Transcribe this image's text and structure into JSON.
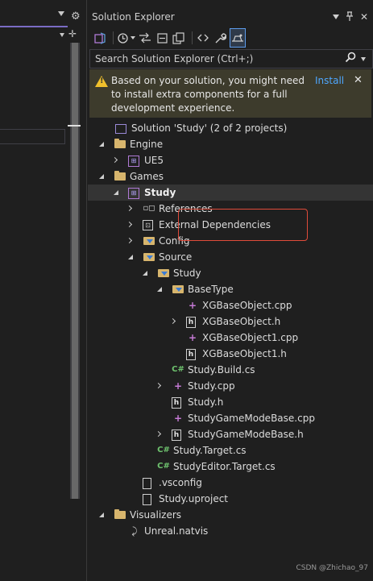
{
  "left_panel": {
    "gear_glyph": "⚙",
    "plus_glyph": "✛"
  },
  "solution_explorer": {
    "title": "Solution Explorer",
    "title_controls": {
      "pin": "⊥",
      "close": "✕"
    },
    "toolbar_icons": [
      "vs-switch-icon",
      "history-icon",
      "back-forward-icon",
      "collapse-all-icon",
      "show-all-files-icon",
      "code-view-icon",
      "properties-wrench-icon",
      "preview-selected-icon"
    ],
    "search": {
      "placeholder": "Search Solution Explorer (Ctrl+;)"
    },
    "info_bar": {
      "message": "Based on your solution, you might need to install extra components for a full development experience.",
      "install_label": "Install",
      "close_glyph": "✕"
    },
    "tree": [
      {
        "label": "Solution 'Study' (2 of 2 projects)",
        "icon": "solution-icon",
        "expander": "none"
      },
      {
        "label": "Engine",
        "icon": "folder-icon",
        "expander": "open"
      },
      {
        "label": "UE5",
        "icon": "project-icon",
        "expander": "closed"
      },
      {
        "label": "Games",
        "icon": "folder-icon",
        "expander": "open"
      },
      {
        "label": "Study",
        "icon": "project-icon",
        "expander": "open",
        "bold": true,
        "selected": true
      },
      {
        "label": "References",
        "icon": "references-icon",
        "expander": "closed"
      },
      {
        "label": "External Dependencies",
        "icon": "external-dependencies-icon",
        "expander": "closed"
      },
      {
        "label": "Config",
        "icon": "filter-folder-icon",
        "expander": "closed"
      },
      {
        "label": "Source",
        "icon": "filter-folder-icon",
        "expander": "open"
      },
      {
        "label": "Study",
        "icon": "filter-folder-icon",
        "expander": "open"
      },
      {
        "label": "BaseType",
        "icon": "filter-folder-icon",
        "expander": "open"
      },
      {
        "label": "XGBaseObject.cpp",
        "icon": "cpp-file-icon",
        "expander": "none"
      },
      {
        "label": "XGBaseObject.h",
        "icon": "header-file-icon",
        "expander": "closed"
      },
      {
        "label": "XGBaseObject1.cpp",
        "icon": "cpp-file-icon",
        "expander": "none"
      },
      {
        "label": "XGBaseObject1.h",
        "icon": "header-file-icon",
        "expander": "none"
      },
      {
        "label": "Study.Build.cs",
        "icon": "csharp-file-icon",
        "expander": "none"
      },
      {
        "label": "Study.cpp",
        "icon": "cpp-file-icon",
        "expander": "closed"
      },
      {
        "label": "Study.h",
        "icon": "header-file-icon",
        "expander": "none"
      },
      {
        "label": "StudyGameModeBase.cpp",
        "icon": "cpp-file-icon",
        "expander": "none"
      },
      {
        "label": "StudyGameModeBase.h",
        "icon": "header-file-icon",
        "expander": "closed"
      },
      {
        "label": "Study.Target.cs",
        "icon": "csharp-file-icon",
        "expander": "none"
      },
      {
        "label": "StudyEditor.Target.cs",
        "icon": "csharp-file-icon",
        "expander": "none"
      },
      {
        "label": ".vsconfig",
        "icon": "file-icon",
        "expander": "none"
      },
      {
        "label": "Study.uproject",
        "icon": "file-icon",
        "expander": "none"
      },
      {
        "label": "Visualizers",
        "icon": "folder-icon",
        "expander": "open"
      },
      {
        "label": "Unreal.natvis",
        "icon": "natvis-file-icon",
        "expander": "none"
      }
    ]
  },
  "watermark": "CSDN @Zhichao_97",
  "colors": {
    "background": "#1f1f1f",
    "info_bar": "#3d3b2c",
    "link": "#4ea7ff",
    "highlight_box": "#e04b3a",
    "folder": "#d7b56d"
  }
}
